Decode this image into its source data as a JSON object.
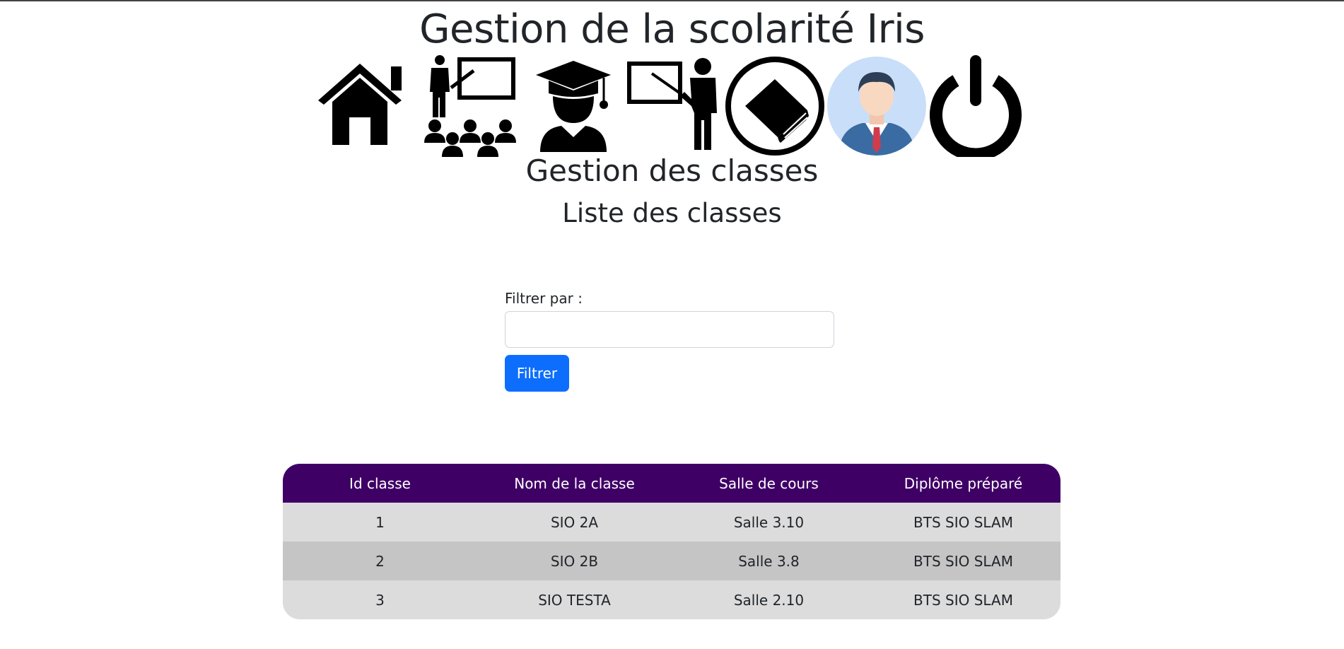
{
  "header": {
    "title": "Gestion de la scolarité Iris"
  },
  "nav": {
    "icons": [
      "home-icon",
      "class-presentation-icon",
      "graduate-student-icon",
      "teacher-icon",
      "book-icon",
      "user-avatar-icon",
      "power-icon"
    ]
  },
  "page": {
    "section_title": "Gestion des classes",
    "subtitle": "Liste des classes"
  },
  "filter": {
    "label": "Filtrer par :",
    "value": "",
    "placeholder": "",
    "button_label": "Filtrer",
    "button_color": "#0d6efd"
  },
  "table": {
    "header_color": "#3f0066",
    "columns": [
      "Id classe",
      "Nom de la classe",
      "Salle de cours",
      "Diplôme préparé"
    ],
    "rows": [
      [
        "1",
        "SIO 2A",
        "Salle 3.10",
        "BTS SIO SLAM"
      ],
      [
        "2",
        "SIO 2B",
        "Salle 3.8",
        "BTS SIO SLAM"
      ],
      [
        "3",
        "SIO TESTA",
        "Salle 2.10",
        "BTS SIO SLAM"
      ]
    ]
  }
}
